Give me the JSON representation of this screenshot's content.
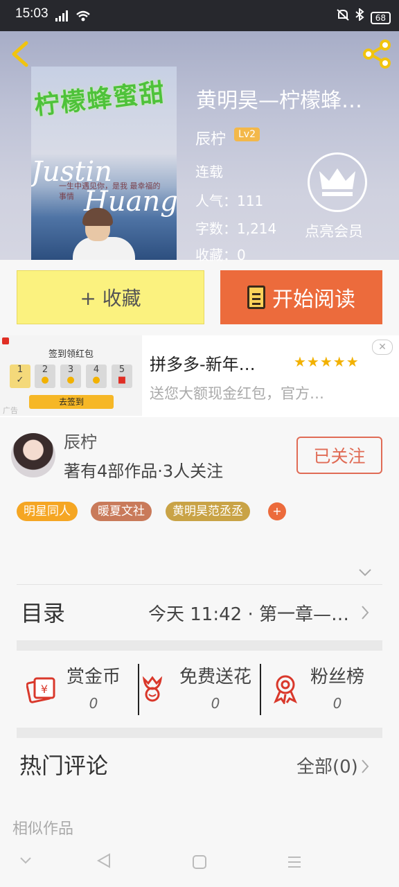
{
  "status": {
    "time": "15:03",
    "battery": "68"
  },
  "book": {
    "cover_title": "柠檬蜂蜜甜",
    "cover_name1": "Justin",
    "cover_name2": "Huang",
    "cover_line": "一生中遇见你，是我 最幸福的事情",
    "title": "黄明昊—柠檬蜂…",
    "author": "辰柠",
    "level": "Lv2",
    "status": "连载",
    "popularity": "人气：111",
    "words": "字数：1,214",
    "favorites": "收藏：0",
    "vip_label": "点亮会员"
  },
  "actions": {
    "collect_label": "+ 收藏",
    "read_label": "开始阅读"
  },
  "ad": {
    "banner_title": "签到领红包",
    "days": [
      "1",
      "2",
      "3",
      "4",
      "5"
    ],
    "go_label": "去签到",
    "ad_mark": "广告",
    "title": "拼多多-新年…",
    "stars": "★★★★★",
    "subtitle": "送您大额现金红包，官方…",
    "close": "✕"
  },
  "author_row": {
    "name": "辰柠",
    "stats": "著有4部作品·3人关注",
    "follow_label": "已关注"
  },
  "tags": [
    {
      "label": "明星同人",
      "color": "#f5a623"
    },
    {
      "label": "暖夏文社",
      "color": "#c97a5a"
    },
    {
      "label": "黄明昊范丞丞",
      "color": "#c9a346"
    }
  ],
  "tag_plus": "+",
  "toc": {
    "label": "目录",
    "latest": "今天 11:42 · 第一章—…"
  },
  "stats": [
    {
      "label": "赏金币",
      "value": "0",
      "color": "#d9382b"
    },
    {
      "label": "免费送花",
      "value": "0",
      "color": "#d9382b"
    },
    {
      "label": "粉丝榜",
      "value": "0",
      "color": "#d9382b"
    }
  ],
  "comments": {
    "label": "热门评论",
    "all_label": "全部(0)"
  },
  "similar_label": "相似作品"
}
